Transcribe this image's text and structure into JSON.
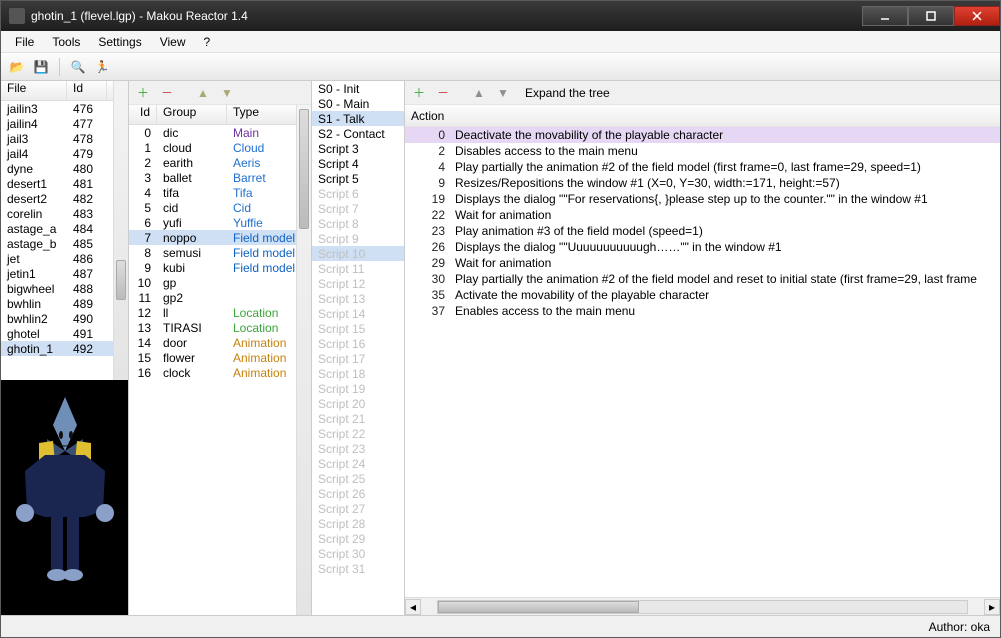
{
  "titlebar": {
    "title": "ghotin_1 (flevel.lgp) - Makou Reactor 1.4"
  },
  "menubar": [
    "File",
    "Tools",
    "Settings",
    "View",
    "?"
  ],
  "statusbar": {
    "author": "Author: oka"
  },
  "left_panel": {
    "headers": [
      "File",
      "Id"
    ],
    "rows": [
      {
        "name": "jailin3",
        "id": "476"
      },
      {
        "name": "jailin4",
        "id": "477"
      },
      {
        "name": "jail3",
        "id": "478"
      },
      {
        "name": "jail4",
        "id": "479"
      },
      {
        "name": "dyne",
        "id": "480"
      },
      {
        "name": "desert1",
        "id": "481"
      },
      {
        "name": "desert2",
        "id": "482"
      },
      {
        "name": "corelin",
        "id": "483"
      },
      {
        "name": "astage_a",
        "id": "484"
      },
      {
        "name": "astage_b",
        "id": "485"
      },
      {
        "name": "jet",
        "id": "486"
      },
      {
        "name": "jetin1",
        "id": "487"
      },
      {
        "name": "bigwheel",
        "id": "488"
      },
      {
        "name": "bwhlin",
        "id": "489"
      },
      {
        "name": "bwhlin2",
        "id": "490"
      },
      {
        "name": "ghotel",
        "id": "491"
      },
      {
        "name": "ghotin_1",
        "id": "492",
        "sel": true
      }
    ]
  },
  "groups_panel": {
    "headers": [
      "Id",
      "Group",
      "Type"
    ],
    "rows": [
      {
        "id": "0",
        "grp": "dic",
        "type": "Main",
        "cls": "type-main"
      },
      {
        "id": "1",
        "grp": "cloud",
        "type": "Cloud",
        "cls": "type-char"
      },
      {
        "id": "2",
        "grp": "earith",
        "type": "Aeris",
        "cls": "type-char"
      },
      {
        "id": "3",
        "grp": "ballet",
        "type": "Barret",
        "cls": "type-char"
      },
      {
        "id": "4",
        "grp": "tifa",
        "type": "Tifa",
        "cls": "type-char"
      },
      {
        "id": "5",
        "grp": "cid",
        "type": "Cid",
        "cls": "type-char"
      },
      {
        "id": "6",
        "grp": "yufi",
        "type": "Yuffie",
        "cls": "type-char"
      },
      {
        "id": "7",
        "grp": "noppo",
        "type": "Field model",
        "cls": "type-field",
        "sel": true
      },
      {
        "id": "8",
        "grp": "semusi",
        "type": "Field model",
        "cls": "type-field"
      },
      {
        "id": "9",
        "grp": "kubi",
        "type": "Field model",
        "cls": "type-field"
      },
      {
        "id": "10",
        "grp": "gp",
        "type": "",
        "cls": ""
      },
      {
        "id": "11",
        "grp": "gp2",
        "type": "",
        "cls": ""
      },
      {
        "id": "12",
        "grp": "ll",
        "type": "Location",
        "cls": "type-loc"
      },
      {
        "id": "13",
        "grp": "TIRASI",
        "type": "Location",
        "cls": "type-loc"
      },
      {
        "id": "14",
        "grp": "door",
        "type": "Animation",
        "cls": "type-anim"
      },
      {
        "id": "15",
        "grp": "flower",
        "type": "Animation",
        "cls": "type-anim"
      },
      {
        "id": "16",
        "grp": "clock",
        "type": "Animation",
        "cls": "type-anim"
      }
    ]
  },
  "scripts": {
    "items": [
      {
        "label": "S0 - Init"
      },
      {
        "label": "S0 - Main"
      },
      {
        "label": "S1 - Talk",
        "sel": true
      },
      {
        "label": "S2 - Contact"
      },
      {
        "label": "Script 3"
      },
      {
        "label": "Script 4"
      },
      {
        "label": "Script 5"
      },
      {
        "label": "Script 6",
        "faded": true
      },
      {
        "label": "Script 7",
        "faded": true
      },
      {
        "label": "Script 8",
        "faded": true
      },
      {
        "label": "Script 9",
        "faded": true
      },
      {
        "label": "Script 10",
        "faded": true,
        "sel_faded": true
      },
      {
        "label": "Script 11",
        "faded": true
      },
      {
        "label": "Script 12",
        "faded": true
      },
      {
        "label": "Script 13",
        "faded": true
      },
      {
        "label": "Script 14",
        "faded": true
      },
      {
        "label": "Script 15",
        "faded": true
      },
      {
        "label": "Script 16",
        "faded": true
      },
      {
        "label": "Script 17",
        "faded": true
      },
      {
        "label": "Script 18",
        "faded": true
      },
      {
        "label": "Script 19",
        "faded": true
      },
      {
        "label": "Script 20",
        "faded": true
      },
      {
        "label": "Script 21",
        "faded": true
      },
      {
        "label": "Script 22",
        "faded": true
      },
      {
        "label": "Script 23",
        "faded": true
      },
      {
        "label": "Script 24",
        "faded": true
      },
      {
        "label": "Script 25",
        "faded": true
      },
      {
        "label": "Script 26",
        "faded": true
      },
      {
        "label": "Script 27",
        "faded": true
      },
      {
        "label": "Script 28",
        "faded": true
      },
      {
        "label": "Script 29",
        "faded": true
      },
      {
        "label": "Script 30",
        "faded": true
      },
      {
        "label": "Script 31",
        "faded": true
      }
    ]
  },
  "actions": {
    "header": "Action",
    "expand": "Expand the tree",
    "rows": [
      {
        "n": "0",
        "t": "Deactivate the movability of the playable character",
        "sel": true
      },
      {
        "n": "2",
        "t": "Disables access to the main menu"
      },
      {
        "n": "4",
        "t": "Play partially the animation #2 of the field model (first frame=0, last frame=29, speed=1)"
      },
      {
        "n": "9",
        "t": "Resizes/Repositions the window #1 (X=0, Y=30, width:=171, height:=57)"
      },
      {
        "n": "19",
        "t": "Displays the dialog \"\"For reservations{, }please step up to the counter.\"\" in the window #1"
      },
      {
        "n": "22",
        "t": "Wait for animation"
      },
      {
        "n": "23",
        "t": "Play animation #3 of the field model (speed=1)"
      },
      {
        "n": "26",
        "t": "Displays the dialog \"\"Uuuuuuuuuuugh……\"\" in the window #1"
      },
      {
        "n": "29",
        "t": "Wait for animation"
      },
      {
        "n": "30",
        "t": "Play partially the animation #2 of the field model and reset to initial state (first frame=29, last frame"
      },
      {
        "n": "35",
        "t": "Activate the movability of the playable character"
      },
      {
        "n": "37",
        "t": "Enables access to the main menu"
      }
    ]
  }
}
